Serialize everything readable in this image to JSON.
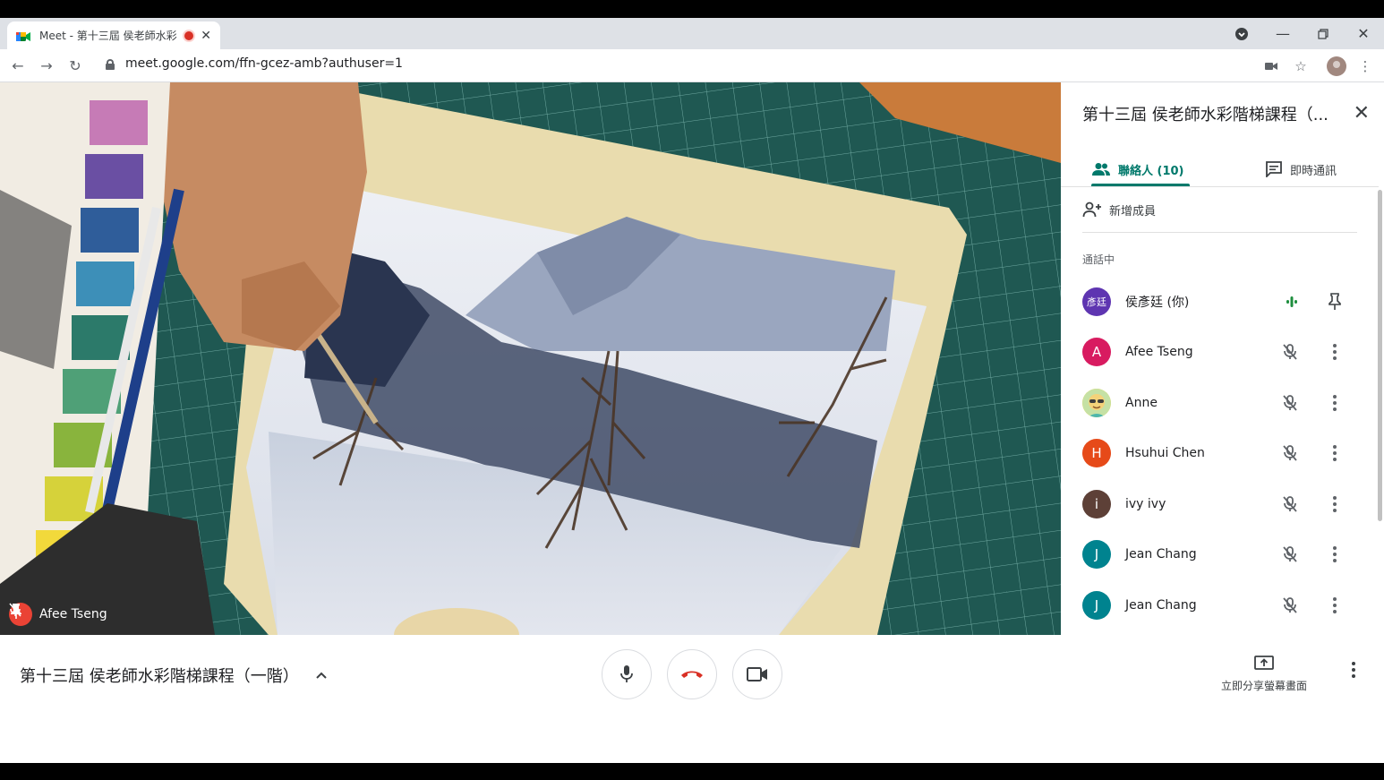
{
  "browser": {
    "tab_title": "Meet - 第十三屆 侯老師水彩",
    "url": "meet.google.com/ffn-gcez-amb?authuser=1",
    "icons": [
      "meet-favicon",
      "recording-dot",
      "close-icon",
      "back-icon",
      "forward-icon",
      "reload-icon",
      "lock-icon",
      "camera-icon",
      "star-icon",
      "profile-avatar",
      "kebab-icon"
    ]
  },
  "video": {
    "presenter_name": "Afee Tseng",
    "icons": [
      "pin-icon",
      "mic-off-icon"
    ]
  },
  "panel": {
    "title": "第十三屆 侯老師水彩階梯課程（...",
    "tabs": [
      {
        "label": "聯絡人 (10)",
        "icon": "people-icon",
        "active": true
      },
      {
        "label": "即時通訊",
        "icon": "chat-icon",
        "active": false
      }
    ],
    "add_member": "新增成員",
    "section_label": "通話中",
    "members": [
      {
        "name": "侯彥廷 (你)",
        "avatar_text": "彥廷",
        "avatar_color": "#5e35b1",
        "self": true
      },
      {
        "name": "Afee Tseng",
        "avatar_text": "A",
        "avatar_color": "#d81b60"
      },
      {
        "name": "Anne",
        "avatar_text": "",
        "avatar_color": "#fdd835"
      },
      {
        "name": "Hsuhui Chen",
        "avatar_text": "H",
        "avatar_color": "#e64a19"
      },
      {
        "name": "ivy ivy",
        "avatar_text": "i",
        "avatar_color": "#5d4037"
      },
      {
        "name": "Jean Chang",
        "avatar_text": "J",
        "avatar_color": "#00838f"
      },
      {
        "name": "Jean Chang",
        "avatar_text": "J",
        "avatar_color": "#00838f"
      }
    ]
  },
  "bottom": {
    "meeting_title": "第十三屆 侯老師水彩階梯課程（一階）",
    "share_label": "立即分享螢幕畫面",
    "icons": [
      "chevron-up-icon",
      "mic-icon",
      "hangup-icon",
      "camera-icon",
      "present-icon",
      "kebab-icon"
    ]
  },
  "colors": {
    "accent": "#00796b",
    "danger": "#ea4335",
    "speaking": "#1e8e3e"
  }
}
